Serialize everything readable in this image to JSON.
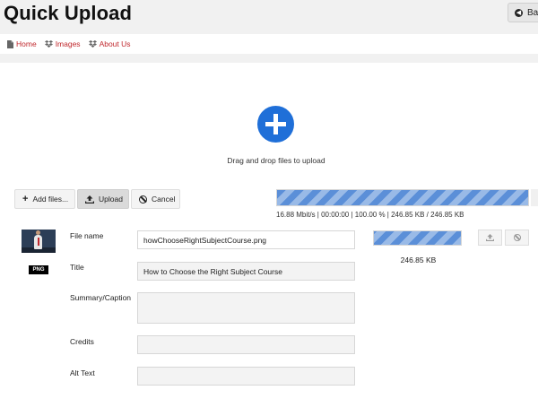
{
  "header": {
    "title": "Quick Upload",
    "back_label": "Back"
  },
  "breadcrumb": [
    {
      "label": "Home",
      "icon": "page-icon"
    },
    {
      "label": "Images",
      "icon": "dropbox-icon"
    },
    {
      "label": "About Us",
      "icon": "dropbox-icon"
    }
  ],
  "dropzone": {
    "icon": "plus-circle-icon",
    "text": "Drag and drop files to upload",
    "accent": "#1f6fd8"
  },
  "toolbar": {
    "add_label": "Add files...",
    "upload_label": "Upload",
    "cancel_label": "Cancel"
  },
  "progress": {
    "percent": 100,
    "stats": "16.88 Mbit/s | 00:00:00 | 100.00 % | 246.85 KB / 246.85 KB",
    "bar_color": "#5b8fd8"
  },
  "file": {
    "type_badge": "PNG",
    "labels": {
      "file_name": "File name",
      "title": "Title",
      "summary": "Summary/Caption",
      "credits": "Credits",
      "alt_text": "Alt Text"
    },
    "values": {
      "file_name": "howChooseRightSubjectCourse.png",
      "title": "How to Choose the Right Subject Course",
      "summary": "",
      "credits": "",
      "alt_text": ""
    },
    "progress_percent": 100,
    "size": "246.85 KB"
  }
}
